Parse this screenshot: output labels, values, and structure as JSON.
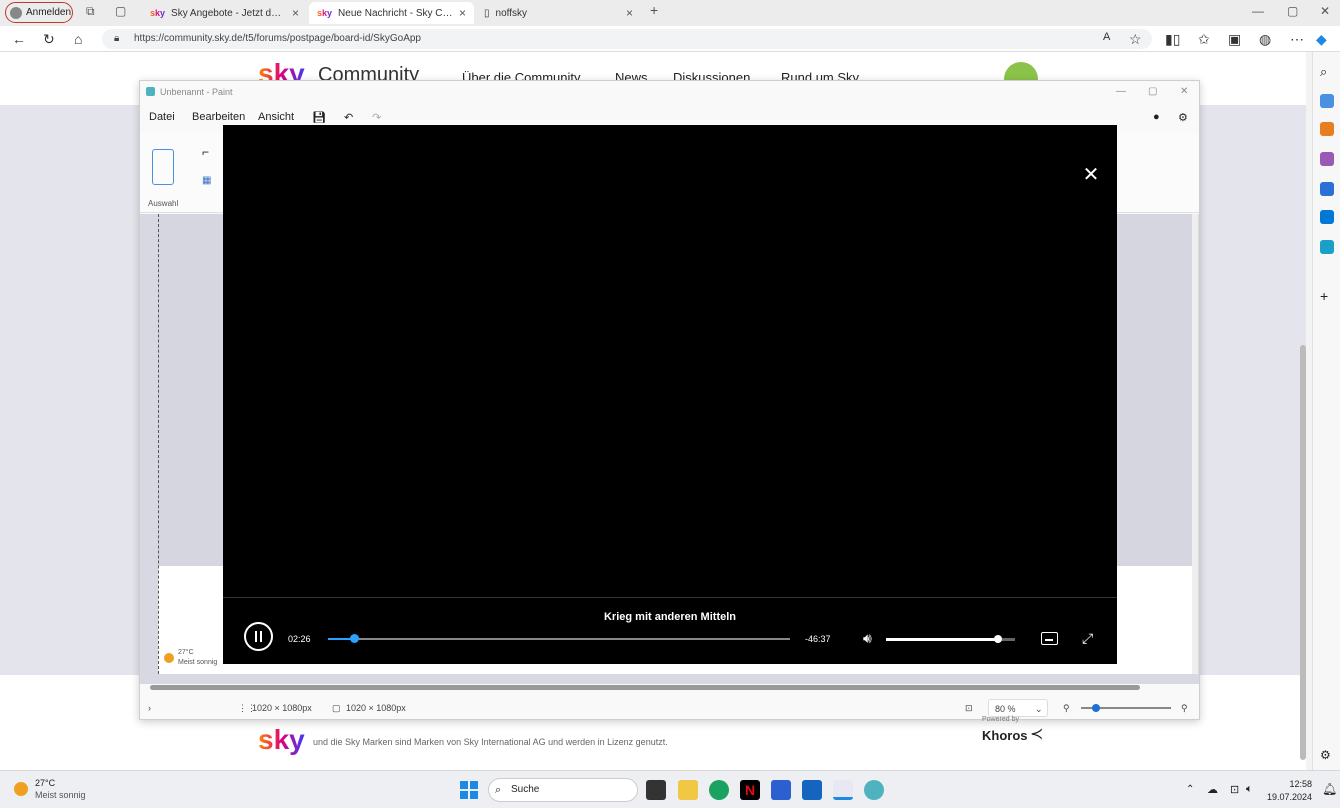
{
  "browser": {
    "profile_label": "Anmelden",
    "tabs": [
      {
        "title": "Sky Angebote - Jetzt dein Abo si",
        "active": false,
        "favicon": "sky"
      },
      {
        "title": "Neue Nachricht - Sky Communit",
        "active": true,
        "favicon": "sky"
      },
      {
        "title": "noffsky",
        "active": false,
        "favicon": "page"
      }
    ],
    "url": "https://community.sky.de/t5/forums/postpage/board-id/SkyGoApp"
  },
  "site": {
    "logo": "sky",
    "logo_suffix": "Community",
    "nav": [
      "Über die Community",
      "News",
      "Diskussionen",
      "Rund um Sky"
    ]
  },
  "paint": {
    "title": "Unbenannt - Paint",
    "menu": [
      "Datei",
      "Bearbeiten",
      "Ansicht"
    ],
    "ribbon_label": "Auswahl",
    "status_dims1": "1020 × 1080px",
    "status_dims2": "1020 × 1080px",
    "zoom": "80 %"
  },
  "player": {
    "title": "Krieg mit anderen Mitteln",
    "elapsed": "02:26",
    "remaining": "-46:37",
    "progress": 0.056,
    "volume": 0.87
  },
  "footer": {
    "logo": "sky",
    "text": "und die Sky Marken sind Marken von Sky International AG und werden in Lizenz genutzt.",
    "powered_by": "Powered by",
    "khoros": "Khoros"
  },
  "taskbar": {
    "weather_temp": "27°C",
    "weather_desc": "Meist sonnig",
    "search_placeholder": "Suche",
    "time": "12:58",
    "date": "19.07.2024"
  }
}
